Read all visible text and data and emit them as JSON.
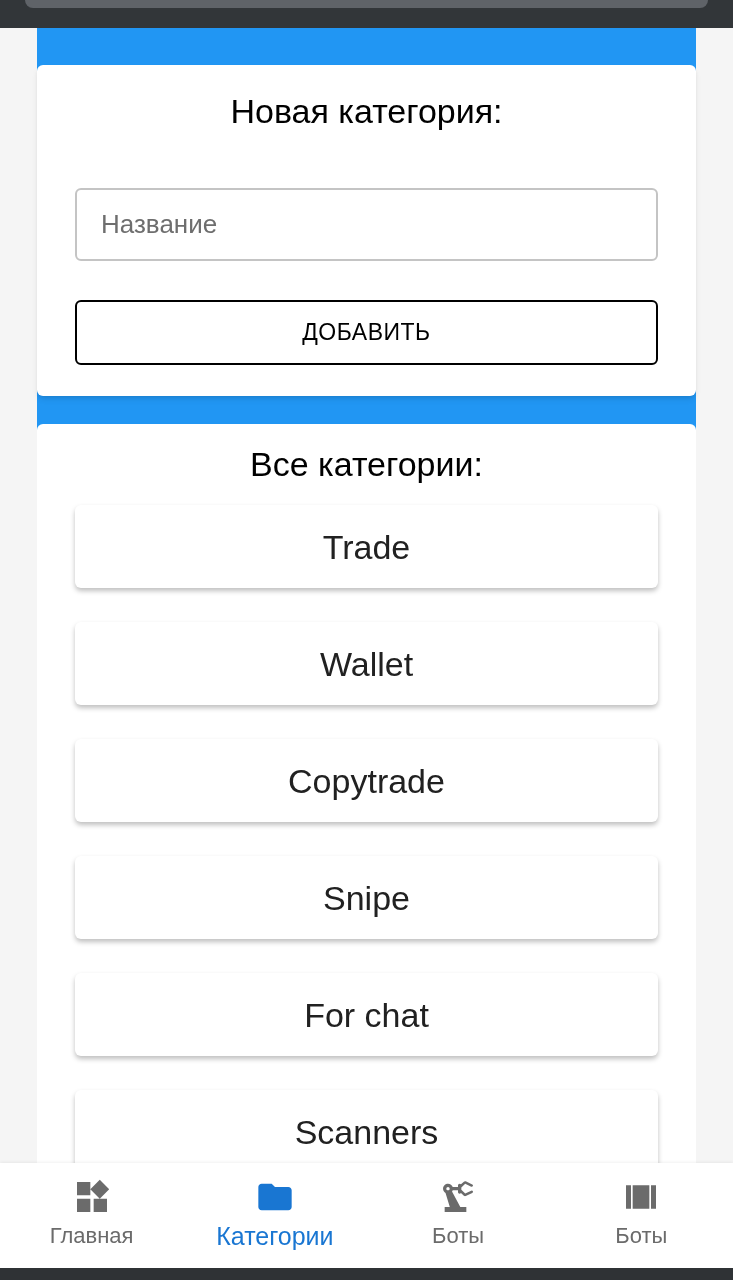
{
  "new_category": {
    "title": "Новая категория:",
    "name_field": {
      "placeholder": "Название"
    },
    "add_button": "ДОБАВИТЬ"
  },
  "all_categories": {
    "title": "Все категории:",
    "items": [
      {
        "label": "Trade"
      },
      {
        "label": "Wallet"
      },
      {
        "label": "Copytrade"
      },
      {
        "label": "Snipe"
      },
      {
        "label": "For chat"
      },
      {
        "label": "Scanners"
      }
    ]
  },
  "bottom_nav": [
    {
      "label": "Главная",
      "kind": "widgets",
      "selected": false
    },
    {
      "label": "Категории",
      "kind": "folder",
      "selected": true
    },
    {
      "label": "Боты",
      "kind": "robot",
      "selected": false
    },
    {
      "label": "Боты",
      "kind": "carousel",
      "selected": false
    }
  ]
}
